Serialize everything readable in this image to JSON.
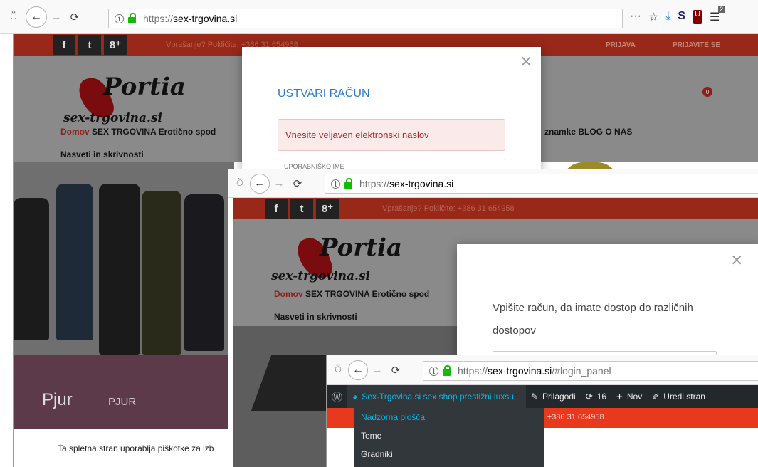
{
  "window1": {
    "url_proto": "https://",
    "url_domain": "sex-trgovina.si",
    "toolbar_right_icons": [
      "···",
      "☆",
      "⤓",
      "S",
      "U",
      "☰"
    ],
    "ublock_badge": "2",
    "social": [
      "f",
      "t",
      "8⁺"
    ],
    "phone": "Vprašanje? Pokličite: +386 31 654958",
    "link_prijava": "PRIJAVA",
    "link_prijavite": "PRIJAVITE SE",
    "logo_title": "Portia",
    "logo_sub": "sex-trgovina.si",
    "nav_active": "Domov",
    "nav_items": "SEX TRGOVINA   Erotično spod",
    "nav_right": "znamke   BLOG   O NAS",
    "nav_second": "Nasveti in skrivnosti",
    "cart_count": "0",
    "banner_text": "Pjur",
    "banner_text2": "PJUR",
    "cookie_text": "Ta spletna stran uporablja piškotke za izb",
    "modal": {
      "close": "×",
      "title": "USTVARI RAČUN",
      "alert": "Vnesite veljaven elektronski naslov",
      "field_placeholder": "UPORABNIŠKO IME"
    }
  },
  "window2": {
    "url_proto": "https://",
    "url_domain": "sex-trgovina.si",
    "social": [
      "f",
      "t",
      "8⁺"
    ],
    "phone": "Vprašanje? Pokličite: +386 31 654958",
    "logo_title": "Portia",
    "logo_sub": "sex-trgovina.si",
    "nav_active": "Domov",
    "nav_items": "SEX TRGOVINA   Erotično spod",
    "nav_second": "Nasveti in skrivnosti",
    "modal": {
      "close": "×",
      "text": "Vpišite račun, da imate dostop do različnih dostopov"
    }
  },
  "window3": {
    "url_proto": "https://",
    "url_domain": "sex-trgovina.si",
    "url_hash": "/#login_panel",
    "wp_site": "Sex-Trgovina.si sex shop prestižni luxsu...",
    "wp_customize": "Prilagodi",
    "wp_updates": "16",
    "wp_new": "Nov",
    "wp_edit": "Uredi stran",
    "phone_partial": "ite: +386 31 654958",
    "menu": [
      "Nadzorna plošča",
      "Teme",
      "Gradniki"
    ]
  }
}
